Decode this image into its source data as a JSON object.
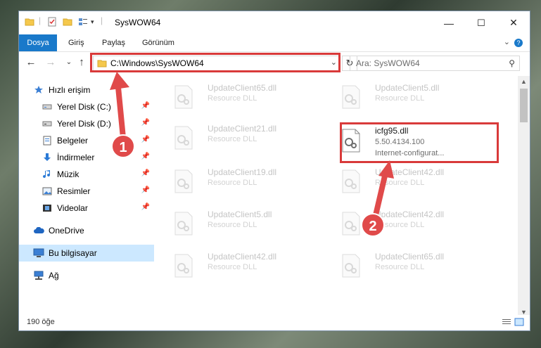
{
  "window": {
    "title": "SysWOW64",
    "controls": {
      "minimize": "—",
      "maximize": "☐",
      "close": "✕"
    }
  },
  "ribbon": {
    "tabs": [
      "Dosya",
      "Giriş",
      "Paylaş",
      "Görünüm"
    ],
    "help": "?"
  },
  "nav": {
    "address": "C:\\Windows\\SysWOW64",
    "search_placeholder": "Ara: SysWOW64"
  },
  "sidebar": {
    "items": [
      {
        "label": "Hızlı erişim",
        "icon": "star-icon",
        "pinned": false
      },
      {
        "label": "Yerel Disk (C:)",
        "icon": "drive-icon",
        "pinned": true
      },
      {
        "label": "Yerel Disk (D:)",
        "icon": "drive-icon",
        "pinned": true
      },
      {
        "label": "Belgeler",
        "icon": "document-icon",
        "pinned": true
      },
      {
        "label": "İndirmeler",
        "icon": "download-icon",
        "pinned": true
      },
      {
        "label": "Müzik",
        "icon": "music-icon",
        "pinned": true
      },
      {
        "label": "Resimler",
        "icon": "pictures-icon",
        "pinned": true
      },
      {
        "label": "Videolar",
        "icon": "video-icon",
        "pinned": true
      },
      {
        "label": "OneDrive",
        "icon": "cloud-icon",
        "pinned": false
      },
      {
        "label": "Bu bilgisayar",
        "icon": "computer-icon",
        "pinned": false,
        "selected": true
      },
      {
        "label": "Ağ",
        "icon": "network-icon",
        "pinned": false
      }
    ]
  },
  "files": [
    {
      "name": "UpdateClient65.dll",
      "sub": "Resource DLL"
    },
    {
      "name": "UpdateClient5.dll",
      "sub": "Resource DLL"
    },
    {
      "name": "UpdateClient21.dll",
      "sub": "Resource DLL"
    },
    {
      "name": "icfg95.dll",
      "sub": "5.50.4134.100",
      "sub2": "Internet-configurat...",
      "highlighted": true
    },
    {
      "name": "UpdateClient19.dll",
      "sub": "Resource DLL"
    },
    {
      "name": "UpdateClient42.dll",
      "sub": "Resource DLL"
    },
    {
      "name": "UpdateClient5.dll",
      "sub": "Resource DLL"
    },
    {
      "name": "UpdateClient42.dll",
      "sub": "Resource DLL"
    },
    {
      "name": "UpdateClient42.dll",
      "sub": "Resource DLL"
    },
    {
      "name": "UpdateClient65.dll",
      "sub": "Resource DLL"
    }
  ],
  "status": {
    "count": "190 öğe"
  },
  "annotations": {
    "marker1": "1",
    "marker2": "2"
  },
  "colors": {
    "accent": "#1979ca",
    "highlight_box": "#d93a3a",
    "selected_bg": "#cce8ff"
  }
}
